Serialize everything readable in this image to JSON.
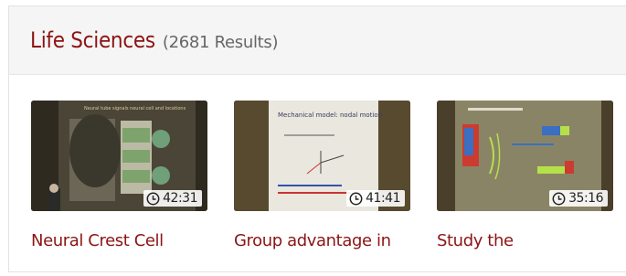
{
  "section": {
    "title": "Life Sciences",
    "count": "(2681 Results)"
  },
  "videos": [
    {
      "title": "Neural Crest Cell",
      "duration": "42:31",
      "slide_heading": "Neural tube signals neural cell and locations"
    },
    {
      "title": "Group advantage in",
      "duration": "41:41",
      "slide_heading": "Mechanical model: nodal motion"
    },
    {
      "title": "Study the",
      "duration": "35:16",
      "slide_heading": ""
    }
  ],
  "colors": {
    "accent": "#8c1414",
    "header_bg": "#f5f5f5"
  },
  "icons": {
    "duration": "clock-icon"
  }
}
